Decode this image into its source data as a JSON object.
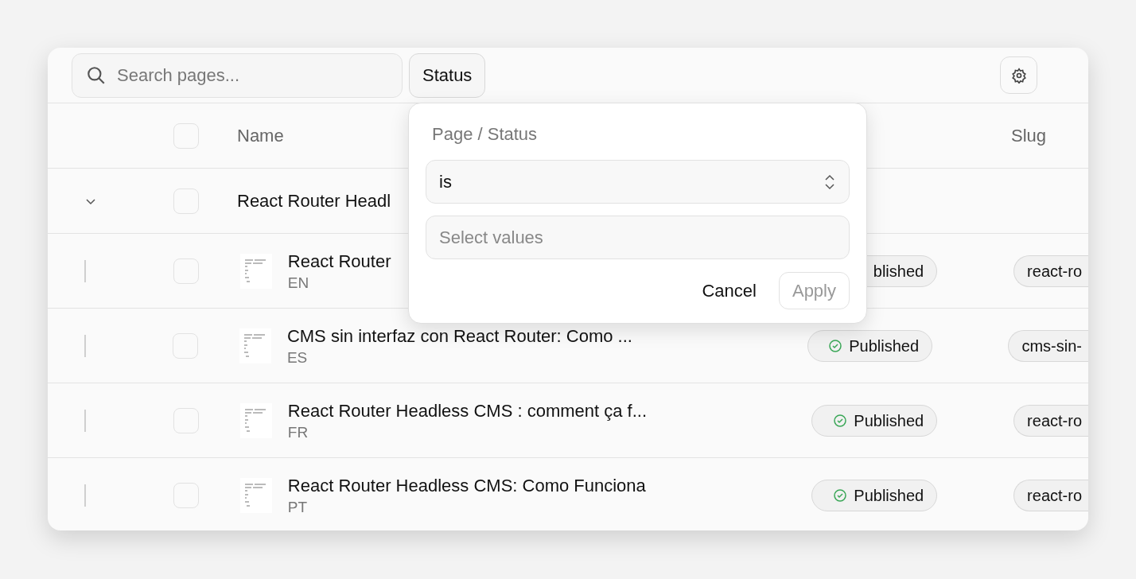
{
  "toolbar": {
    "search": {
      "placeholder": "Search pages..."
    },
    "filter_button": "Status"
  },
  "table": {
    "header": {
      "checked": false,
      "columns": [
        "Name",
        "Slug"
      ]
    },
    "groups": [
      {
        "title": "React Router Headl",
        "expanded": true,
        "checked": false,
        "children": [
          {
            "title": "React Router",
            "lang": "EN",
            "checked": false,
            "status": "blished",
            "status_icon": false,
            "slug": "react-ro"
          },
          {
            "title": "CMS sin interfaz con React Router: Como ...",
            "lang": "ES",
            "checked": false,
            "status": "Published",
            "status_icon": true,
            "slug": "cms-sin-"
          },
          {
            "title": "React Router Headless CMS : comment ça f...",
            "lang": "FR",
            "checked": false,
            "status": "Published",
            "status_icon": true,
            "slug": "react-ro"
          },
          {
            "title": "React Router Headless CMS: Como Funciona",
            "lang": "PT",
            "checked": false,
            "status": "Published",
            "status_icon": true,
            "slug": "react-ro"
          }
        ]
      }
    ]
  },
  "filter_popover": {
    "title": "Page / Status",
    "operator": "is",
    "values_placeholder": "Select values",
    "buttons": [
      {
        "label": "Cancel",
        "kind": "text",
        "disabled": false
      },
      {
        "label": "Apply",
        "kind": "outline",
        "disabled": true
      }
    ]
  }
}
